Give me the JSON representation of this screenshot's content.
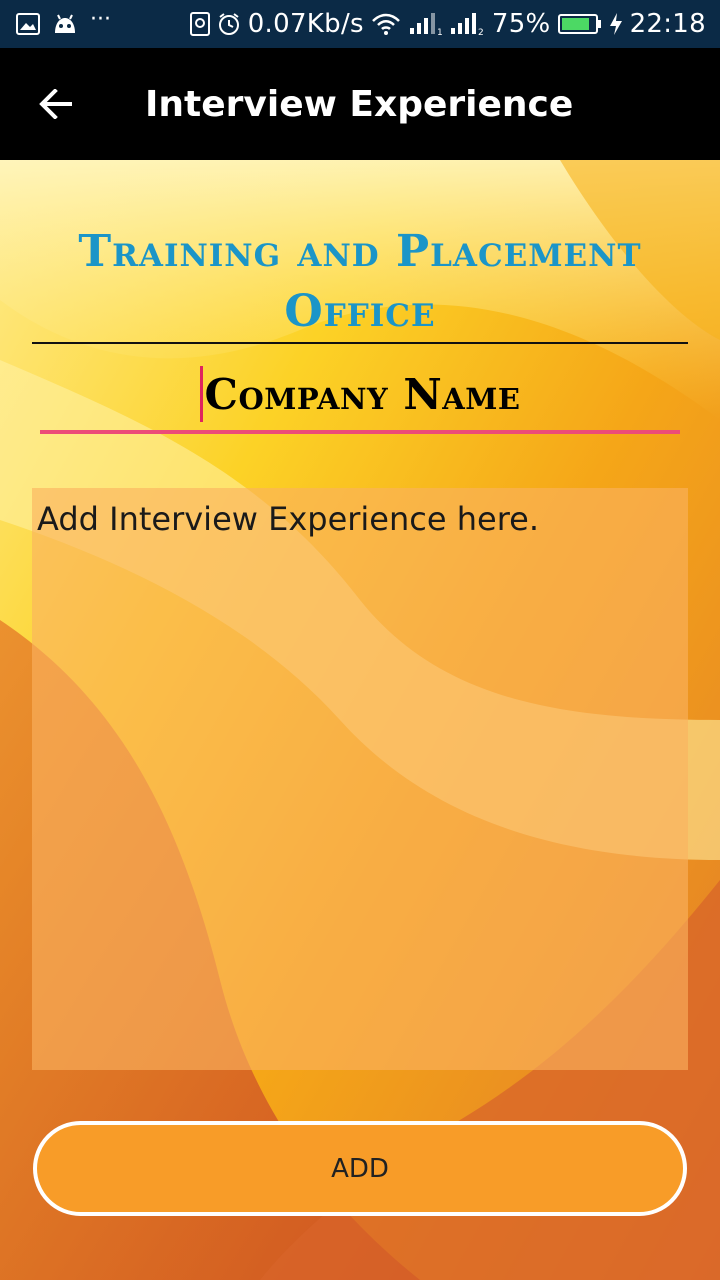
{
  "status_bar": {
    "left_icons": [
      "gallery-icon",
      "android-icon",
      "more-dots-icon"
    ],
    "more_dots": "···",
    "net_speed": "0.07Kb/s",
    "battery": "75%",
    "time": "22:18",
    "right_icons": [
      "screenshot-icon",
      "alarm-icon",
      "wifi-icon",
      "signal-sim1-icon",
      "signal-sim2-icon",
      "battery-icon",
      "charging-icon"
    ]
  },
  "app_bar": {
    "title": "Interview Experience",
    "back_icon": "arrow-back-icon"
  },
  "main": {
    "org_title": "Training and Placement Office",
    "company_name_placeholder": "Company Name",
    "experience_placeholder": "Add Interview Experience here.",
    "add_label": "ADD"
  },
  "colors": {
    "status_bar_bg": "#0b2a46",
    "app_bar_bg": "#000000",
    "title_blue": "#1b95c8",
    "input_underline": "#ec4c78",
    "button_bg": "#f89c28"
  }
}
